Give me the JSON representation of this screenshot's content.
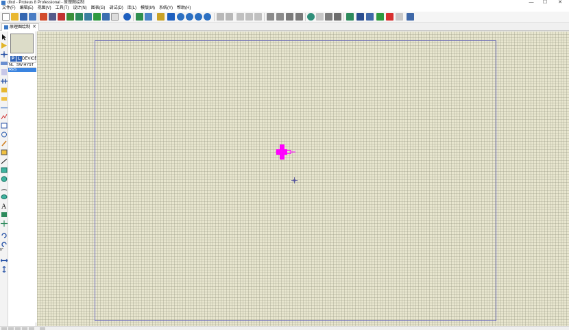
{
  "window": {
    "title": "dlxd - Proteus 8 Professional - 原理图绘制",
    "minimize": "—",
    "maximize": "☐",
    "close": "✕"
  },
  "menu": [
    {
      "label": "文件(F)"
    },
    {
      "label": "编辑(E)"
    },
    {
      "label": "视图(V)"
    },
    {
      "label": "工具(T)"
    },
    {
      "label": "设计(N)"
    },
    {
      "label": "图表(G)"
    },
    {
      "label": "调试(D)"
    },
    {
      "label": "库(L)"
    },
    {
      "label": "模版(M)"
    },
    {
      "label": "系统(Y)"
    },
    {
      "label": "帮助(H)"
    }
  ],
  "tab": {
    "label": "原理图绘制",
    "close": "✕"
  },
  "selector": {
    "pick_button": "P",
    "library_button": "L",
    "devices_label": "DEVICES",
    "columns": [
      "NL",
      "SW HYST"
    ],
    "items": [
      {
        "label": "RES",
        "selected": true
      }
    ]
  },
  "status": {
    "rotation": "0°"
  },
  "colors": {
    "canvas": "#e8e6cf",
    "sheet_border": "#6b6bbf",
    "component": "#ff00ff",
    "selection": "#3a84e0"
  },
  "toolbar_icons": [
    "new-file-icon",
    "open-folder-icon",
    "save-icon",
    "save-all-icon",
    "home-icon",
    "schematic-icon",
    "pcb-icon",
    "3d-icon",
    "gerber-icon",
    "bom-icon",
    "code-icon",
    "source-icon",
    "vsm-icon",
    "help-icon",
    "refresh-icon",
    "grid-icon",
    "origin-icon",
    "pan-icon",
    "zoom-in-icon",
    "zoom-out-icon",
    "zoom-all-icon",
    "zoom-area-icon",
    "undo-icon",
    "redo-icon",
    "cut-icon",
    "copy-icon",
    "paste-icon",
    "block-copy-icon",
    "block-move-icon",
    "block-rotate-icon",
    "block-delete-icon",
    "pick-device-icon",
    "make-device-icon",
    "packaging-icon",
    "decompose-icon",
    "wire-autorouter-icon",
    "search-icon",
    "property-assign-icon",
    "new-sheet-icon",
    "remove-sheet-icon",
    "exit-parent-icon",
    "annotate-icon"
  ]
}
